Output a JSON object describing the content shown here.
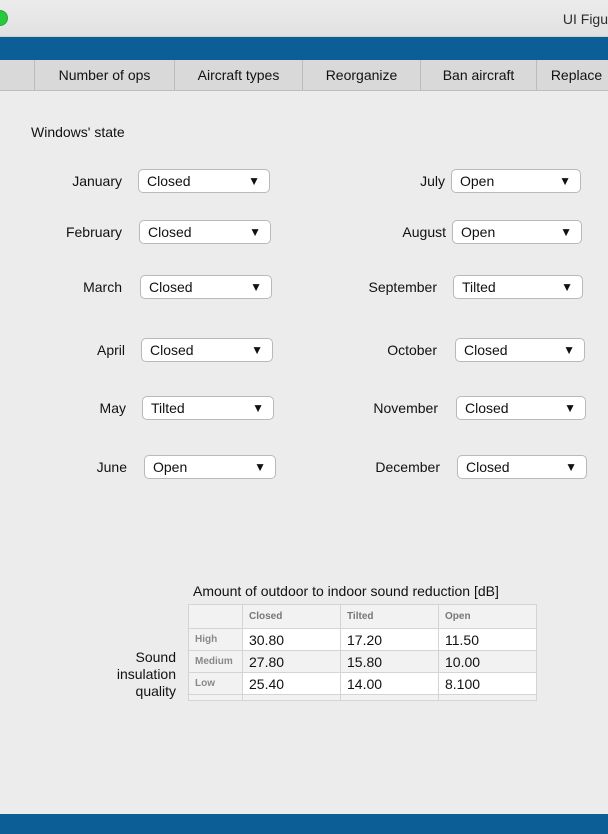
{
  "window": {
    "title": "UI Figu"
  },
  "tabs": [
    "Number of ops",
    "Aircraft types",
    "Reorganize",
    "Ban aircraft",
    "Replace"
  ],
  "panel": {
    "label": "Windows' state"
  },
  "months": [
    {
      "name": "January",
      "value": "Closed"
    },
    {
      "name": "February",
      "value": "Closed"
    },
    {
      "name": "March",
      "value": "Closed"
    },
    {
      "name": "April",
      "value": "Closed"
    },
    {
      "name": "May",
      "value": "Tilted"
    },
    {
      "name": "June",
      "value": "Open"
    },
    {
      "name": "July",
      "value": "Open"
    },
    {
      "name": "August",
      "value": "Open"
    },
    {
      "name": "September",
      "value": "Tilted"
    },
    {
      "name": "October",
      "value": "Closed"
    },
    {
      "name": "November",
      "value": "Closed"
    },
    {
      "name": "December",
      "value": "Closed"
    }
  ],
  "arrow_glyph": "▼",
  "table": {
    "caption": "Amount of outdoor to indoor sound reduction [dB]",
    "row_header_label": "Sound insulation quality",
    "columns": [
      "Closed",
      "Tilted",
      "Open"
    ],
    "rows": [
      {
        "label": "High",
        "values": [
          "30.80",
          "17.20",
          "11.50"
        ]
      },
      {
        "label": "Medium",
        "values": [
          "27.80",
          "15.80",
          "10.00"
        ]
      },
      {
        "label": "Low",
        "values": [
          "25.40",
          "14.00",
          "8.100"
        ]
      }
    ]
  }
}
